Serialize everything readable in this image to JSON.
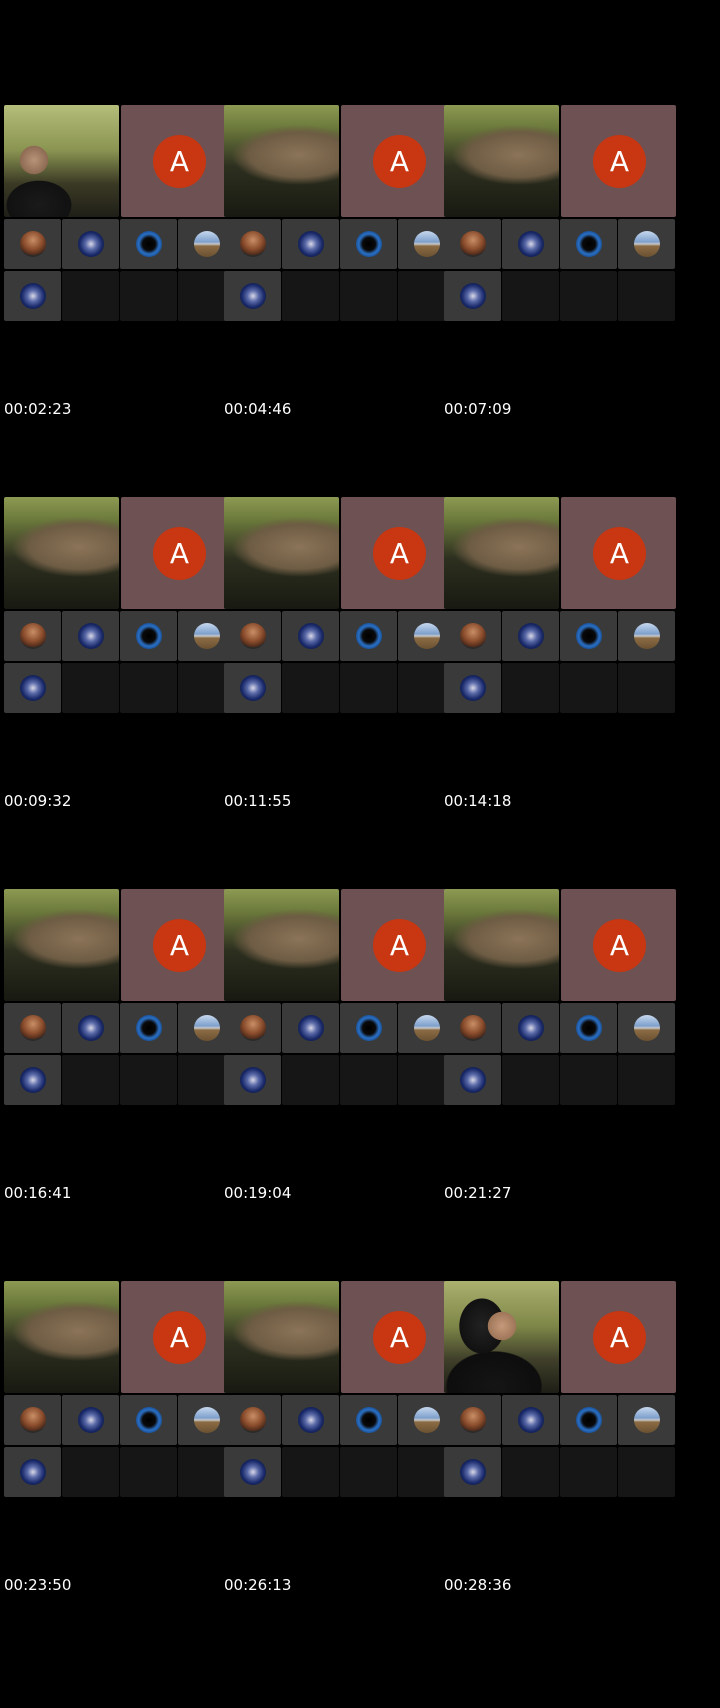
{
  "avatar_initial": "A",
  "colors": {
    "background": "#000000",
    "avatar_tile": "#6e5152",
    "avatar_circle": "#c93612",
    "thumb_tile": "#3a3a3a",
    "empty_tile": "#161616"
  },
  "thumbnail_icons": [
    "person-avatar-icon",
    "seal-emblem-icon",
    "blue-emblem-icon",
    "landscape-hat-icon",
    "seal-emblem-icon"
  ],
  "frames": [
    {
      "timestamp": "00:02:23",
      "camera": "person"
    },
    {
      "timestamp": "00:04:46",
      "camera": "arm"
    },
    {
      "timestamp": "00:07:09",
      "camera": "arm"
    },
    {
      "timestamp": "00:09:32",
      "camera": "arm"
    },
    {
      "timestamp": "00:11:55",
      "camera": "arm"
    },
    {
      "timestamp": "00:14:18",
      "camera": "arm"
    },
    {
      "timestamp": "00:16:41",
      "camera": "arm"
    },
    {
      "timestamp": "00:19:04",
      "camera": "arm"
    },
    {
      "timestamp": "00:21:27",
      "camera": "arm"
    },
    {
      "timestamp": "00:23:50",
      "camera": "arm"
    },
    {
      "timestamp": "00:26:13",
      "camera": "arm"
    },
    {
      "timestamp": "00:28:36",
      "camera": "side"
    }
  ]
}
